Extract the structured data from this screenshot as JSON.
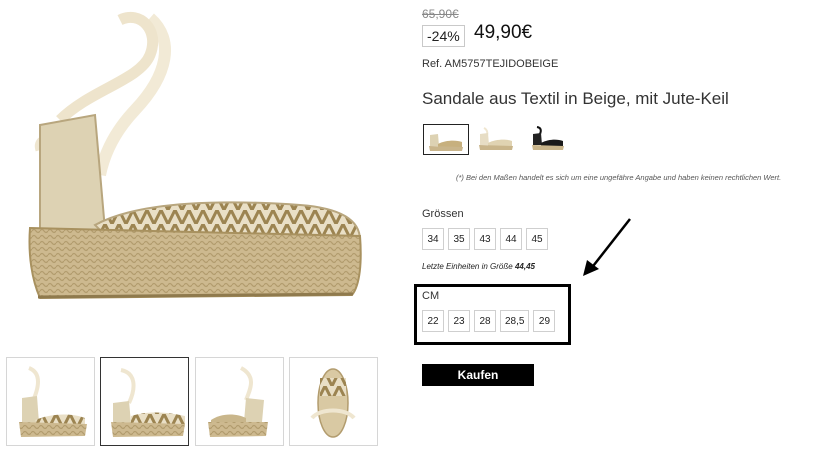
{
  "product": {
    "old_price": "65,90€",
    "discount": "-24%",
    "price": "49,90€",
    "reference": "Ref. AM5757TEJIDOBEIGE",
    "title": "Sandale aus Textil in Beige, mit Jute-Keil",
    "measure_note": "(*) Bei den Maßen handelt es sich um eine ungefähre Angabe und haben keinen rechtlichen Wert.",
    "colors": {
      "swatches": [
        {
          "name": "beige-swatch",
          "selected": true
        },
        {
          "name": "cream-swatch",
          "selected": false
        },
        {
          "name": "black-swatch",
          "selected": false
        }
      ]
    }
  },
  "sizes": {
    "label": "Grössen",
    "items": [
      "34",
      "35",
      "43",
      "44",
      "45"
    ],
    "last_units_prefix": "Letzte Einheiten in Größe ",
    "last_units_sizes": "44,45"
  },
  "cm": {
    "label": "CM",
    "items": [
      "22",
      "23",
      "28",
      "28,5",
      "29"
    ]
  },
  "actions": {
    "buy_label": "Kaufen"
  },
  "gallery": {
    "thumbnails": [
      {
        "name": "thumbnail-side-view",
        "active": false
      },
      {
        "name": "thumbnail-front-side-view",
        "active": true
      },
      {
        "name": "thumbnail-back-side-view",
        "active": false
      },
      {
        "name": "thumbnail-top-view",
        "active": false
      }
    ]
  }
}
